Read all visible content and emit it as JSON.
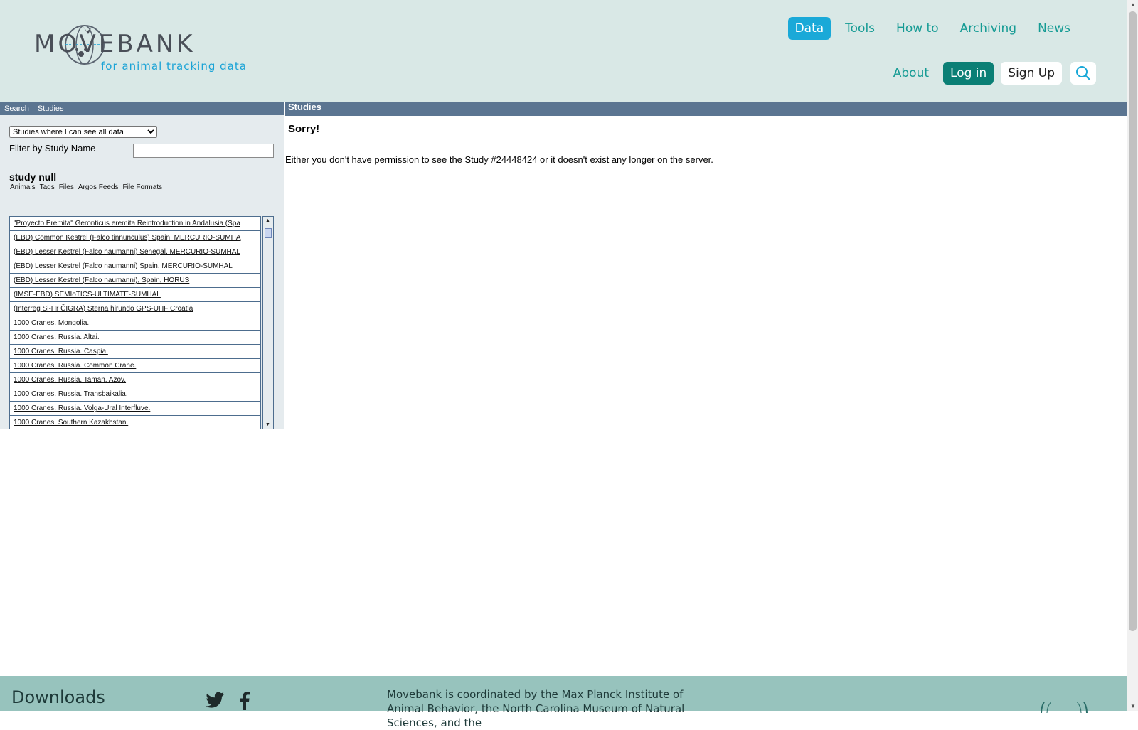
{
  "header": {
    "logo_text": "MOVEBANK",
    "logo_tagline": "for animal tracking data",
    "nav_primary": [
      "Data",
      "Tools",
      "How to",
      "Archiving",
      "News"
    ],
    "nav_about": "About",
    "login_label": "Log in",
    "signup_label": "Sign Up",
    "active_nav": "Data"
  },
  "left_panel": {
    "tabs": [
      "Search",
      "Studies"
    ],
    "view_select": "Studies where I can see all data",
    "filter_label": "Filter by Study Name",
    "filter_value": "",
    "study_title": "study null",
    "study_links": [
      "Animals",
      "Tags",
      "Files",
      "Argos Feeds",
      "File Formats"
    ],
    "studies": [
      "\"Proyecto Eremita\" Geronticus eremita Reintroduction in Andalusia (Spa",
      "(EBD) Common Kestrel (Falco tinnunculus) Spain, MERCURIO-SUMHA",
      "(EBD) Lesser Kestrel (Falco naumanni) Senegal, MERCURIO-SUMHAL",
      "(EBD) Lesser Kestrel (Falco naumanni) Spain, MERCURIO-SUMHAL",
      "(EBD) Lesser Kestrel (Falco naumanni), Spain, HORUS",
      "(IMSE-EBD) SEMIoTICS-ULTIMATE-SUMHAL",
      "(Interreg Si-Hr ČIGRA) Sterna hirundo GPS-UHF Croatia",
      "1000 Cranes. Mongolia.",
      "1000 Cranes. Russia. Altai.",
      "1000 Cranes. Russia. Caspia.",
      "1000 Cranes. Russia. Common Crane.",
      "1000 Cranes. Russia. Taman. Azov.",
      "1000 Cranes. Russia. Transbaikalia.",
      "1000 Cranes. Russia. Volga-Ural Interfluve.",
      "1000 Cranes. Southern Kazakhstan."
    ]
  },
  "main": {
    "header": "Studies",
    "title": "Sorry!",
    "message": "Either you don't have permission to see the Study #24448424 or it doesn't exist any longer on the server."
  },
  "footer": {
    "downloads_title": "Downloads",
    "coordination_text": "Movebank is coordinated by the Max Planck Institute of Animal Behavior, the North Carolina Museum of Natural Sciences, and the",
    "social_icons": [
      "twitter-icon",
      "facebook-icon"
    ]
  },
  "colors": {
    "header_bg": "#d9e8e6",
    "accent": "#1aa9d8",
    "login_bg": "#0b7f75",
    "panel_bar": "#5b7591",
    "footer_bg": "#97c3bd"
  }
}
